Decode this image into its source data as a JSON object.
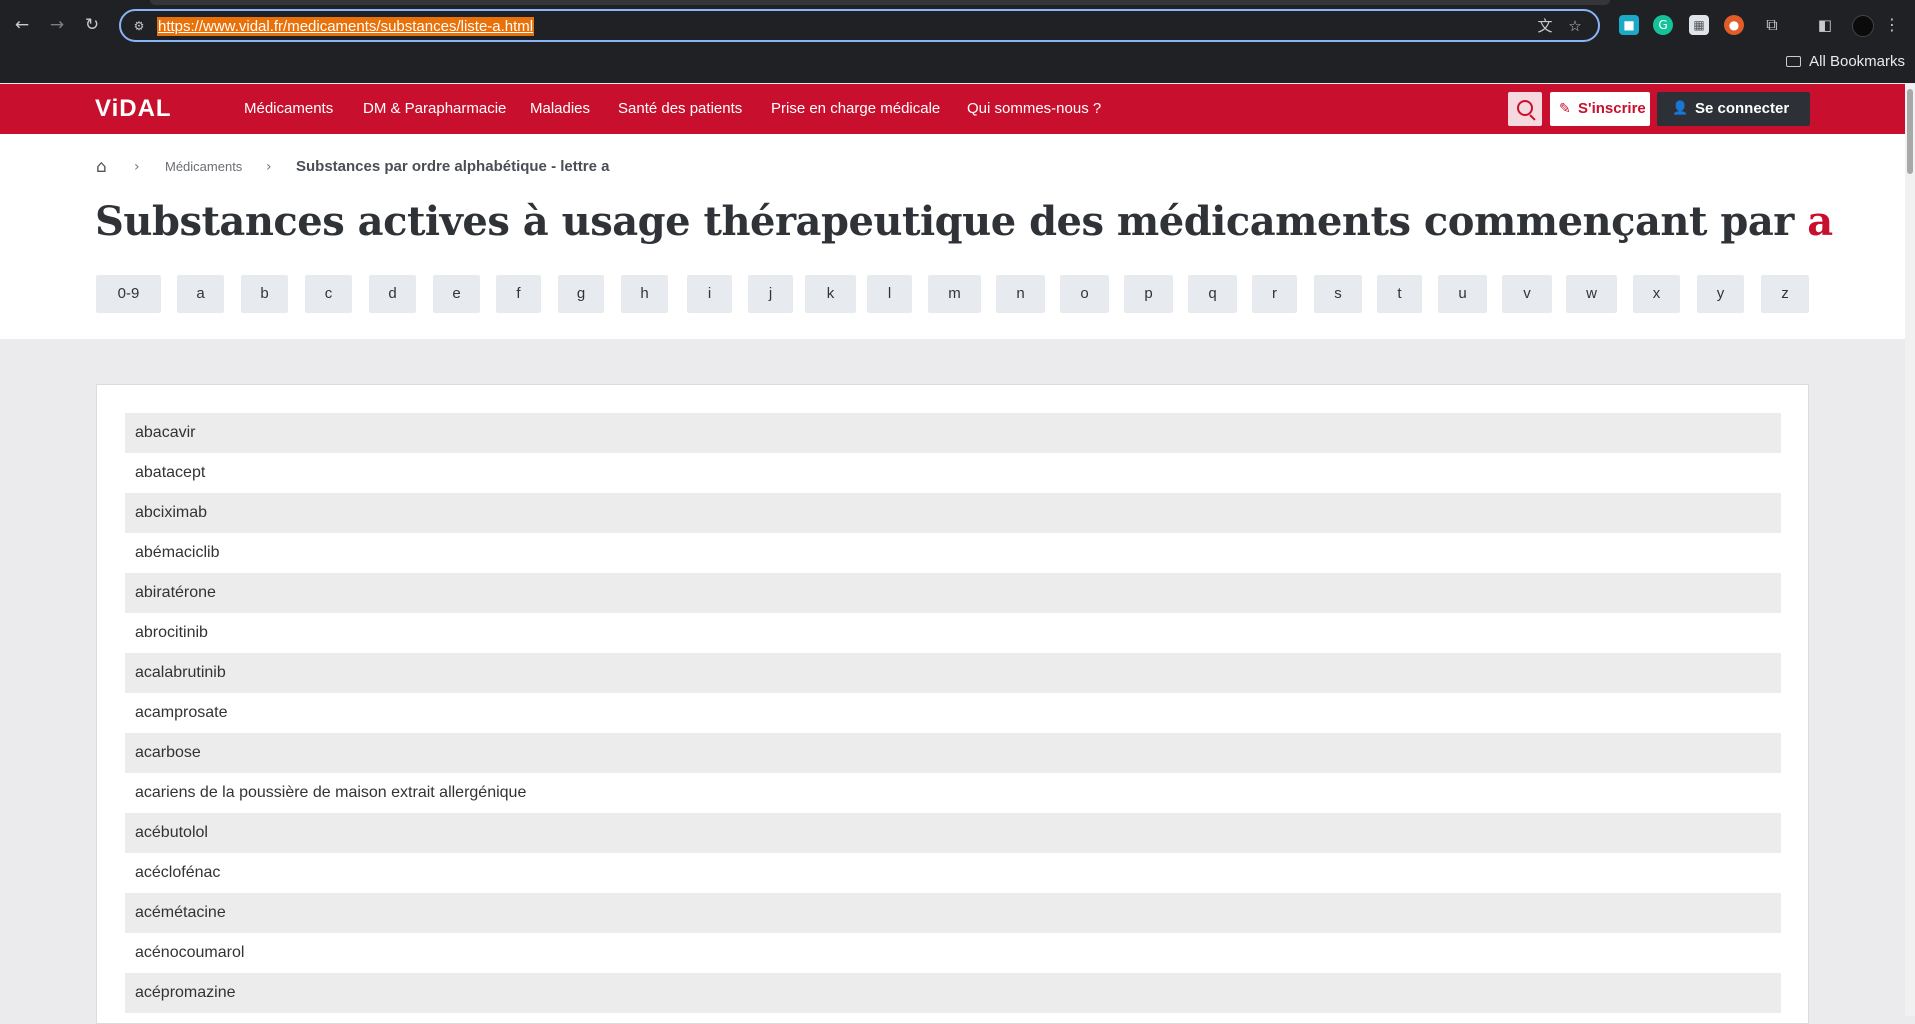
{
  "browser": {
    "url": "https://www.vidal.fr/medicaments/substances/liste-a.html",
    "bookmarks_label": "All Bookmarks"
  },
  "header": {
    "logo": "ViDAL",
    "nav": [
      "Médicaments",
      "DM & Parapharmacie",
      "Maladies",
      "Santé des patients",
      "Prise en charge médicale",
      "Qui sommes-nous ?"
    ],
    "signup_label": "S'inscrire",
    "login_label": "Se connecter",
    "brand_color": "#c8102e"
  },
  "breadcrumb": {
    "link": "Médicaments",
    "current": "Substances par ordre alphabétique - lettre a"
  },
  "title": {
    "text": "Substances actives à usage thérapeutique des médicaments commençant par ",
    "letter": "a"
  },
  "letters": [
    "0-9",
    "a",
    "b",
    "c",
    "d",
    "e",
    "f",
    "g",
    "h",
    "i",
    "j",
    "k",
    "l",
    "m",
    "n",
    "o",
    "p",
    "q",
    "r",
    "s",
    "t",
    "u",
    "v",
    "w",
    "x",
    "y",
    "z"
  ],
  "substances": [
    "abacavir",
    "abatacept",
    "abciximab",
    "abémaciclib",
    "abiratérone",
    "abrocitinib",
    "acalabrutinib",
    "acamprosate",
    "acarbose",
    "acariens de la poussière de maison extrait allergénique",
    "acébutolol",
    "acéclofénac",
    "acémétacine",
    "acénocoumarol",
    "acépromazine"
  ]
}
